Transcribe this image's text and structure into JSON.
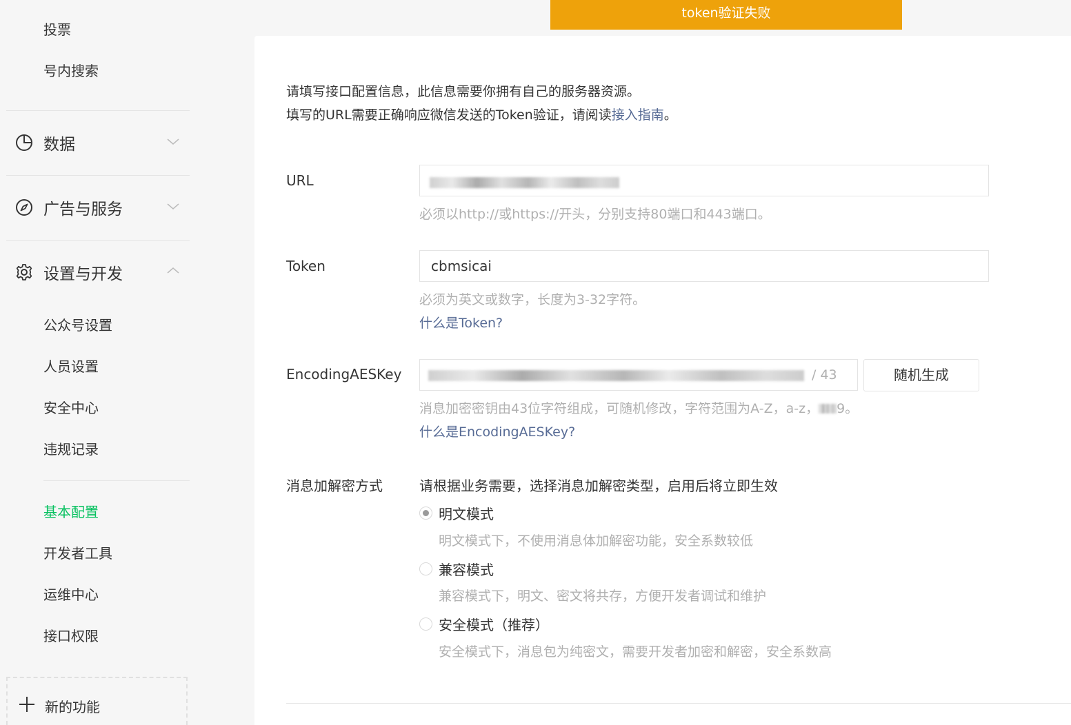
{
  "toast": {
    "message": "token验证失败"
  },
  "sidebar": {
    "top_items": [
      "投票",
      "号内搜索"
    ],
    "groups": {
      "data": "数据",
      "ads": "广告与服务",
      "settings": "设置与开发"
    },
    "settings_items": [
      "公众号设置",
      "人员设置",
      "安全中心",
      "违规记录"
    ],
    "config_items": [
      "基本配置",
      "开发者工具",
      "运维中心",
      "接口权限"
    ],
    "active_item": "基本配置",
    "new_feature": "新的功能"
  },
  "intro": {
    "line1": "请填写接口配置信息，此信息需要你拥有自己的服务器资源。",
    "line2_prefix": "填写的URL需要正确响应微信发送的Token验证，请阅读",
    "line2_link": "接入指南",
    "line2_suffix": "。"
  },
  "form": {
    "url": {
      "label": "URL",
      "hint": "必须以http://或https://开头，分别支持80端口和443端口。"
    },
    "token": {
      "label": "Token",
      "value": "cbmsicai",
      "hint": "必须为英文或数字，长度为3-32字符。",
      "help_link": "什么是Token?"
    },
    "aes": {
      "label": "EncodingAESKey",
      "visible_tail": "/ 43",
      "generate_button": "随机生成",
      "hint": "消息加密密钥由43位字符组成，可随机修改，字符范围为A-Z，a-z，",
      "hint_tail": "9。",
      "help_link": "什么是EncodingAESKey?"
    },
    "encryption": {
      "label": "消息加解密方式",
      "intro": "请根据业务需要，选择消息加解密类型，启用后将立即生效",
      "options": [
        {
          "label": "明文模式",
          "desc": "明文模式下，不使用消息体加解密功能，安全系数较低",
          "checked": true
        },
        {
          "label": "兼容模式",
          "desc": "兼容模式下，明文、密文将共存，方便开发者调试和维护",
          "checked": false
        },
        {
          "label": "安全模式（推荐）",
          "desc": "安全模式下，消息包为纯密文，需要开发者加密和解密，安全系数高",
          "checked": false
        }
      ]
    }
  },
  "colors": {
    "accent": "#07c160",
    "link": "#576b95",
    "toast": "#eea20b",
    "hint": "#b0b0b0"
  }
}
